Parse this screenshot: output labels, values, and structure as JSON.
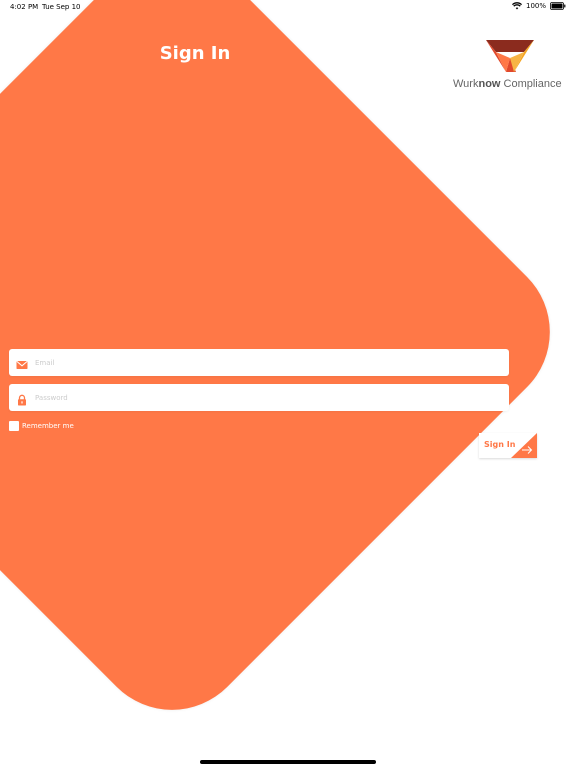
{
  "status_bar": {
    "time": "4:02 PM",
    "date": "Tue Sep 10",
    "battery": "100%"
  },
  "header": {
    "title": "Sign In"
  },
  "brand": {
    "name_part1": "Wurk",
    "name_bold": "now",
    "name_part2": " Compliance",
    "colors": {
      "dark": "#8b2b1e",
      "mid": "#e0492c",
      "light": "#f5a623"
    }
  },
  "form": {
    "email": {
      "placeholder": "Email",
      "value": "",
      "icon": "envelope-icon"
    },
    "password": {
      "placeholder": "Password",
      "value": "",
      "icon": "lock-icon"
    },
    "remember_label": "Remember me",
    "submit_label": "Sign In",
    "submit_icon": "arrow-right-icon"
  },
  "colors": {
    "accent": "#ff7847",
    "background": "#ffffff"
  }
}
